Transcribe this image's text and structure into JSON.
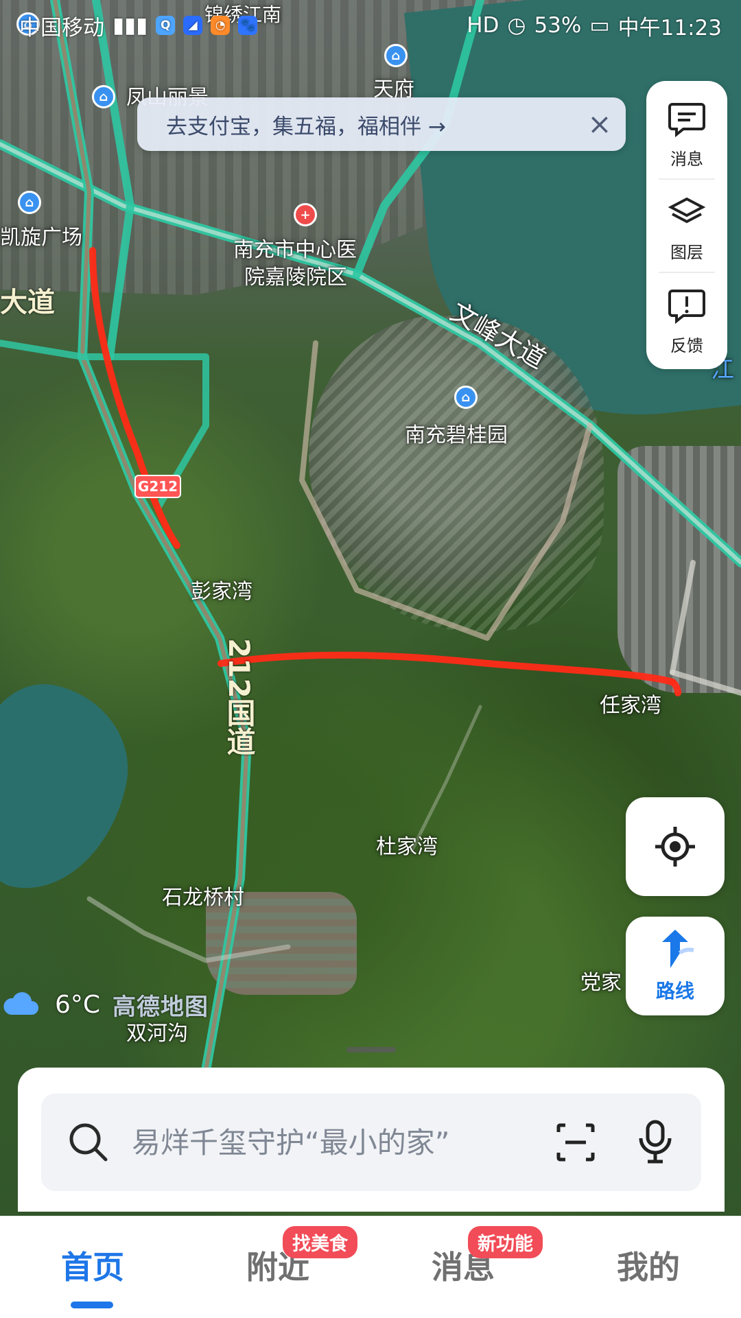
{
  "status_bar": {
    "carrier": "中国移动",
    "network": "HD",
    "battery": "53%",
    "time": "中午11:23",
    "apps": [
      "Q",
      "◢",
      "◔",
      "🐾"
    ]
  },
  "notice": {
    "text": "去支付宝，集五福，福相伴 →"
  },
  "map": {
    "labels": {
      "top_street": "锦绣江南",
      "fengshan": "凤山丽景",
      "tianfu": "天府",
      "kaixuan": "凯旋广场",
      "hospital_line1": "南充市中心医",
      "hospital_line2": "院嘉陵院区",
      "avenue_left": "大道",
      "wenfeng": "文峰大道",
      "river": "江",
      "biguiyuan": "南充碧桂园",
      "g212_badge": "G212",
      "pengjiawan": "彭家湾",
      "renjiawan": "任家湾",
      "national_road": "212国道",
      "dujiawan": "杜家湾",
      "shilongqiao": "石龙桥村",
      "shuanghegou": "双河沟",
      "dangjia": "党家"
    }
  },
  "right_panel": {
    "message": "消息",
    "layers": "图层",
    "feedback": "反馈"
  },
  "weather": {
    "temp": "6°C",
    "brand": "高德地图"
  },
  "controls": {
    "route": "路线"
  },
  "search": {
    "placeholder": "易烊千玺守护“最小的家”"
  },
  "tabbar": {
    "home": "首页",
    "nearby": "附近",
    "nearby_badge": "找美食",
    "messages": "消息",
    "messages_badge": "新功能",
    "mine": "我的"
  }
}
